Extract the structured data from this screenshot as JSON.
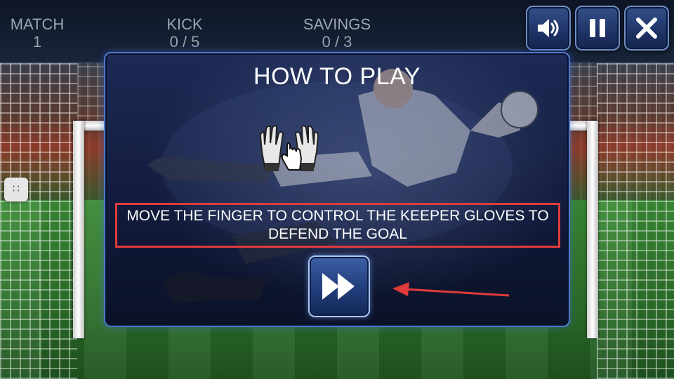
{
  "hud": {
    "match": {
      "label": "MATCH",
      "value": "1"
    },
    "kick": {
      "label": "KICK",
      "value": "0 / 5"
    },
    "savings": {
      "label": "SAVINGS",
      "value": "0 / 3"
    },
    "buttons": [
      {
        "icon": "speaker-icon",
        "name": "sound"
      },
      {
        "icon": "pause-icon",
        "name": "pause"
      },
      {
        "icon": "close-icon",
        "name": "close"
      }
    ]
  },
  "side_handle": {
    "glyph": "∷"
  },
  "dialog": {
    "title": "HOW TO PLAY",
    "instruction": "MOVE THE FINGER TO CONTROL THE KEEPER GLOVES TO DEFEND THE GOAL",
    "next_icon": "fast-forward-icon",
    "illustration_icon": "gloves-hand-icon"
  },
  "colors": {
    "accent": "#4f79c9",
    "highlight_box": "#e03b3b",
    "annotation_arrow": "#e03b3b",
    "hud_text": "#9aa3b0"
  }
}
